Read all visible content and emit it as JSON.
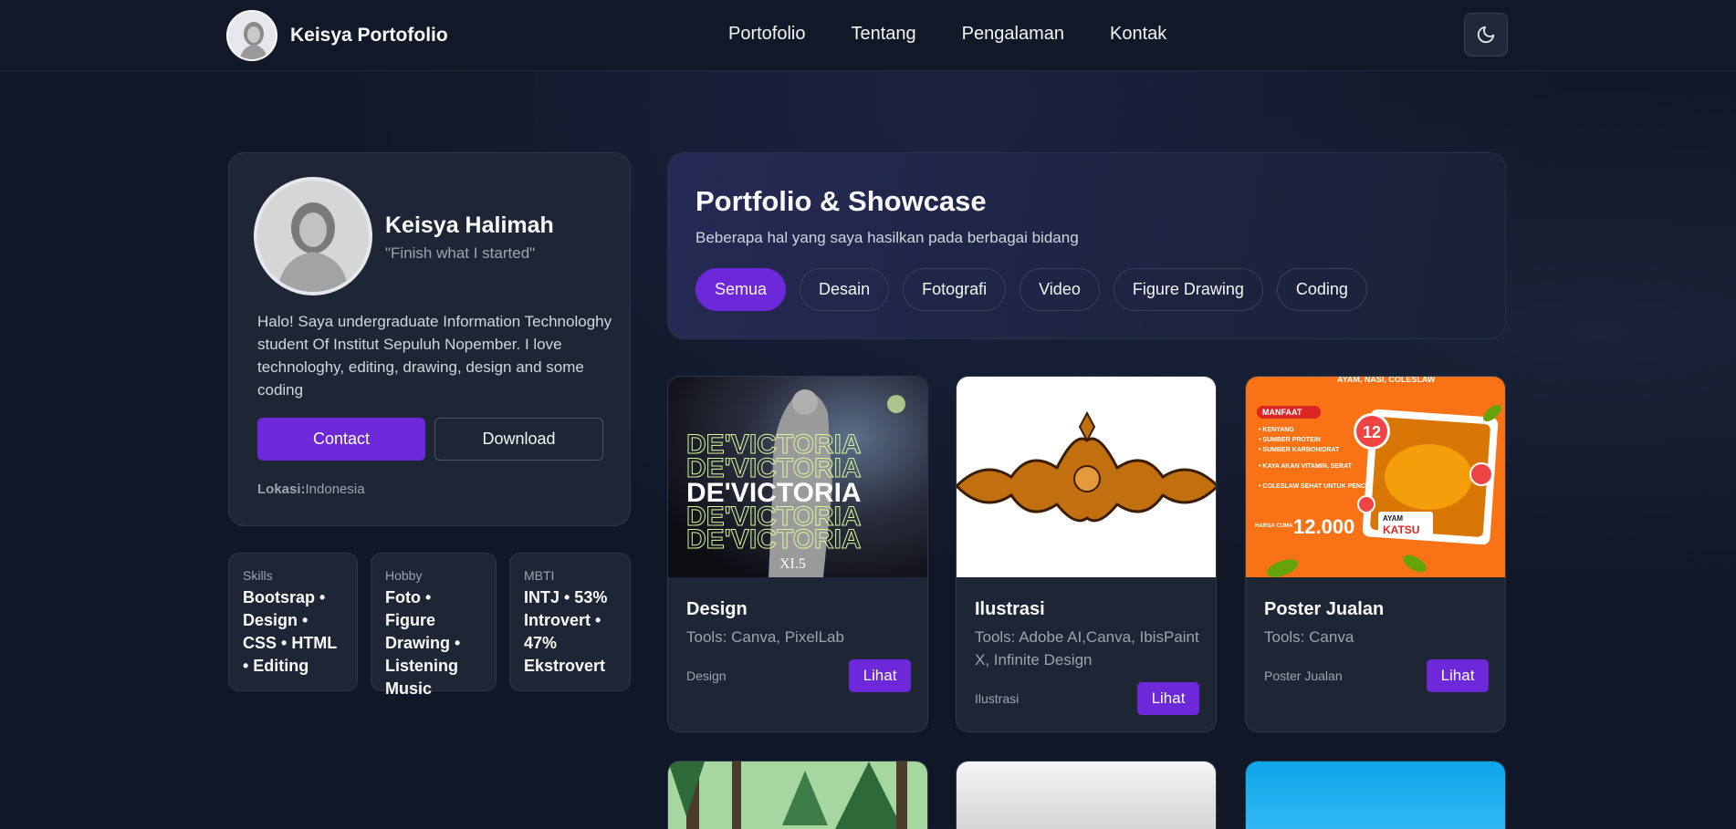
{
  "nav": {
    "brand": "Keisya Portofolio",
    "links": [
      "Portofolio",
      "Tentang",
      "Pengalaman",
      "Kontak"
    ],
    "theme_icon": "moon-icon"
  },
  "profile": {
    "name": "Keisya Halimah",
    "quote": "\"Finish what I started\"",
    "bio": "Halo! Saya undergraduate Information Technologhy student Of Institut Sepuluh Nopember. I love technologhy, editing, drawing, design and some coding",
    "contact_label": "Contact",
    "download_label": "Download",
    "location_label": "Lokasi:",
    "location_value": "Indonesia"
  },
  "info": [
    {
      "label": "Skills",
      "value": "Bootsrap • Design • CSS • HTML • Editing"
    },
    {
      "label": "Hobby",
      "value": "Foto • Figure Drawing • Listening Music"
    },
    {
      "label": "MBTI",
      "value": "INTJ • 53% Introvert • 47% Ekstrovert"
    }
  ],
  "portfolio": {
    "title": "Portfolio & Showcase",
    "subtitle": "Beberapa hal yang saya hasilkan pada berbagai bidang",
    "filters": [
      "Semua",
      "Desain",
      "Fotografi",
      "Video",
      "Figure Drawing",
      "Coding"
    ],
    "active_filter": "Semua"
  },
  "cards": [
    {
      "title": "Design",
      "tools": "Tools: Canva, PixelLab",
      "category": "Design",
      "button": "Lihat",
      "image_text": "DE'VICTORIA",
      "image_caption": "XI.5"
    },
    {
      "title": "Ilustrasi",
      "tools": "Tools: Adobe AI,Canva, IbisPaint X, Infinite Design",
      "category": "Ilustrasi",
      "button": "Lihat"
    },
    {
      "title": "Poster Jualan",
      "tools": "Tools: Canva",
      "category": "Poster Jualan",
      "button": "Lihat",
      "poster": {
        "top": "AYAM, NASI, COLESLAW",
        "heading": "MANFAAT",
        "items": [
          "• KENYANG",
          "• SUMBER PROTEIN",
          "• SUMBER KARBOHIDRAT",
          "• KAYA AKAN VITAMIN, SERAT",
          "• COLESLAW SEHAT UNTUK PENCERNAAN"
        ],
        "badge": "12",
        "price_label": "HARGA CUMA",
        "price": "12.000",
        "name_top": "AYAM",
        "name": "KATSU"
      }
    }
  ],
  "colors": {
    "accent": "#6d28d9",
    "background": "#101828",
    "card": "#1e2636"
  }
}
